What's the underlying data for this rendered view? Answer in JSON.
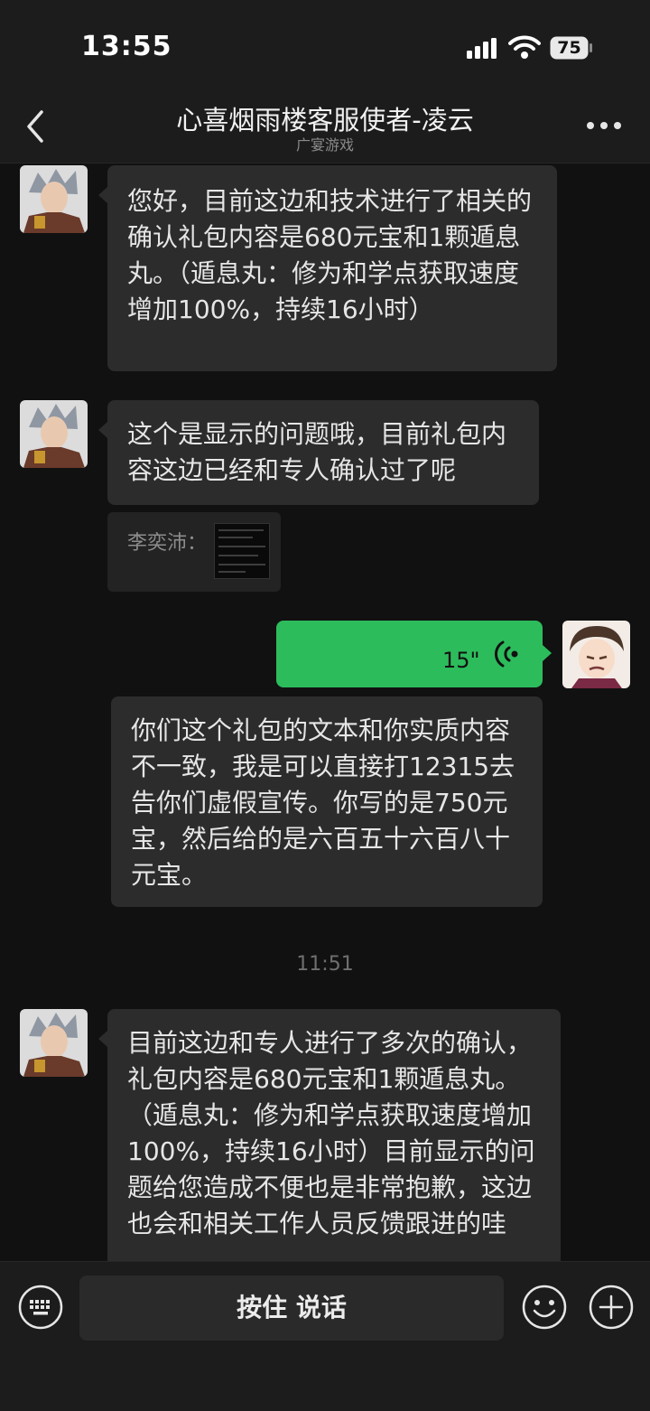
{
  "status_bar": {
    "time": "13:55",
    "battery": "75"
  },
  "header": {
    "title": "心喜烟雨楼客服使者-凌云",
    "subtitle": "广宴游戏"
  },
  "messages": {
    "m1": "您好，目前这边和技术进行了相关的确认礼包内容是680元宝和1颗遁息丸。（遁息丸：修为和学点获取速度增加100%，持续16小时）",
    "m2": "这个是显示的问题哦，目前礼包内容这边已经和专人确认过了呢",
    "quote_name": "李奕沛：",
    "voice_duration": "15\"",
    "m3": "你们这个礼包的文本和你实质内容不一致，我是可以直接打12315去告你们虚假宣传。你写的是750元宝，然后给的是六百五十六百八十元宝。",
    "timestamp": "11:51",
    "m4": "目前这边和专人进行了多次的确认，礼包内容是680元宝和1颗遁息丸。（遁息丸：修为和学点获取速度增加100%，持续16小时）目前显示的问题给您造成不便也是非常抱歉，这边也会和相关工作人员反馈跟进的哇"
  },
  "input_bar": {
    "hold_to_talk": "按住 说话"
  },
  "icons": {
    "back": "chevron-left-icon",
    "more": "more-dots-icon",
    "keyboard": "keyboard-icon",
    "emoji": "emoji-icon",
    "plus": "plus-icon",
    "voice": "voice-wave-icon"
  },
  "colors": {
    "sent_bubble": "#2dbc5c",
    "received_bubble": "#2c2c2c",
    "background": "#111111"
  }
}
